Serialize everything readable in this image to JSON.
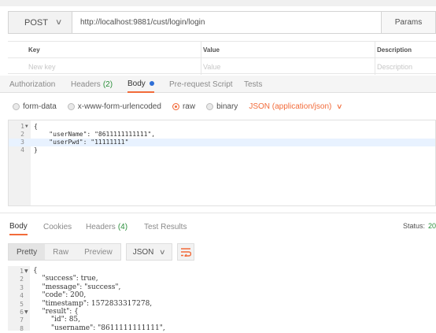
{
  "request": {
    "method": "POST",
    "url": "http://localhost:9881/cust/login/login",
    "params_label": "Params"
  },
  "params_table": {
    "headers": [
      "Key",
      "Value",
      "Description"
    ],
    "placeholders": [
      "New key",
      "Value",
      "Description"
    ]
  },
  "request_tabs": {
    "authorization": "Authorization",
    "headers": "Headers",
    "headers_count": "(2)",
    "body": "Body",
    "prerequest": "Pre-request Script",
    "tests": "Tests"
  },
  "body_types": {
    "form_data": "form-data",
    "urlencoded": "x-www-form-urlencoded",
    "raw": "raw",
    "binary": "binary",
    "selected": "raw",
    "content_type": "JSON (application/json)"
  },
  "request_body": {
    "line_numbers": [
      "1",
      "2",
      "3",
      "4"
    ],
    "lines": [
      "{",
      "    \"userName\": \"8611111111111\",",
      "    \"userPwd\": \"11111111\"",
      "}"
    ],
    "highlighted_line": 3
  },
  "response_tabs": {
    "body": "Body",
    "cookies": "Cookies",
    "headers": "Headers",
    "headers_count": "(4)",
    "test_results": "Test Results",
    "status_label": "Status:",
    "status_value": "20"
  },
  "response_toolbar": {
    "pretty": "Pretty",
    "raw": "Raw",
    "preview": "Preview",
    "format": "JSON"
  },
  "response_body": {
    "line_numbers": [
      "1",
      "2",
      "3",
      "4",
      "5",
      "6",
      "7",
      "8"
    ],
    "lines": [
      "{",
      "    \"success\": true,",
      "    \"message\": \"success\",",
      "    \"code\": 200,",
      "    \"timestamp\": 1572833317278,",
      "    \"result\": {",
      "        \"id\": 85,",
      "        \"username\": \"8611111111111\","
    ]
  },
  "colors": {
    "accent": "#f26b3a",
    "count_green": "#2a8f3a",
    "json_string": "#1b47a8",
    "dot_blue": "#2f6fd6"
  }
}
